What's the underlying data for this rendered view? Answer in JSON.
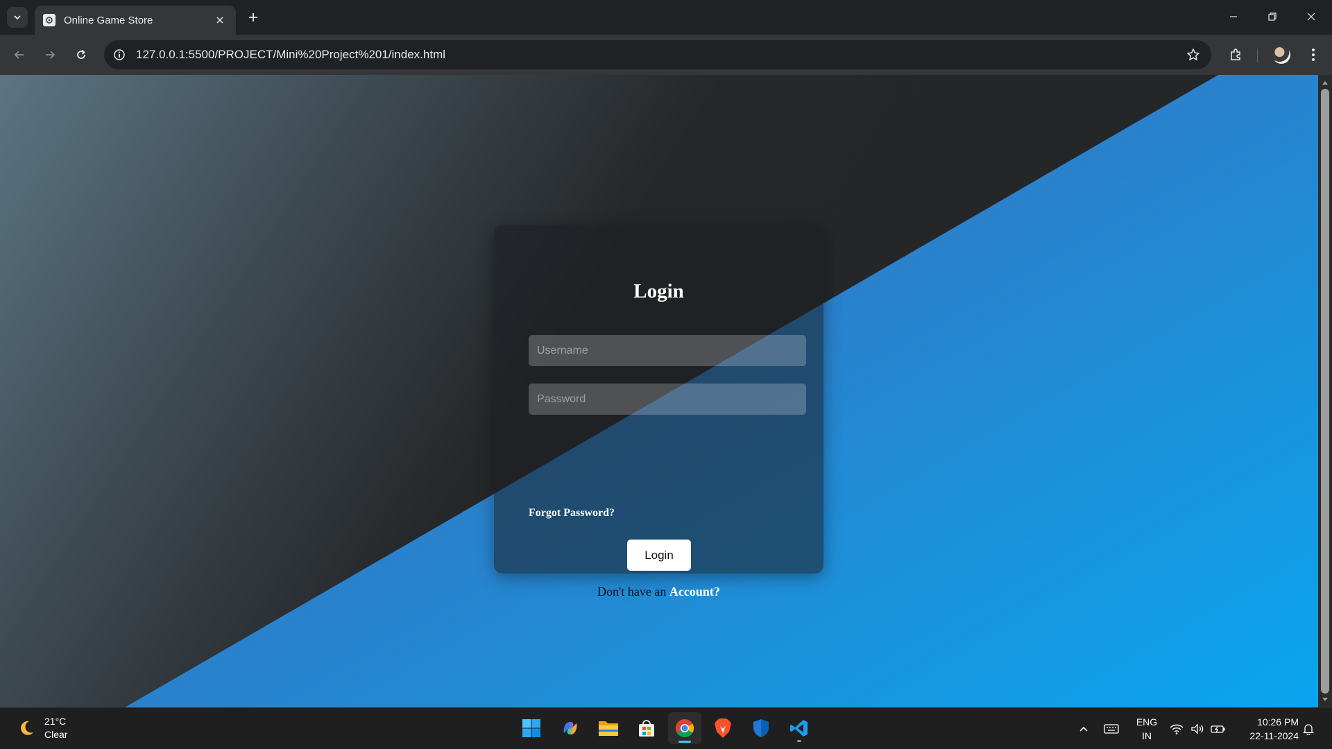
{
  "browser": {
    "tab_title": "Online Game Store",
    "url": "127.0.0.1:5500/PROJECT/Mini%20Project%201/index.html"
  },
  "login": {
    "title": "Login",
    "username_placeholder": "Username",
    "password_placeholder": "Password",
    "forgot_label": "Forgot Password?",
    "button_label": "Login",
    "signup_prefix": "Don't have an ",
    "signup_link": "Account?"
  },
  "taskbar": {
    "weather_temp": "21°C",
    "weather_desc": "Clear",
    "apps": [
      "start",
      "copilot",
      "file-explorer",
      "microsoft-store",
      "chrome",
      "brave",
      "defender",
      "vscode"
    ],
    "lang_line1": "ENG",
    "lang_line2": "IN",
    "time": "10:26 PM",
    "date": "22-11-2024"
  },
  "colors": {
    "page_dark": "#242526",
    "page_blue": "#1e8fd9",
    "accent": "#4cc2ff"
  }
}
